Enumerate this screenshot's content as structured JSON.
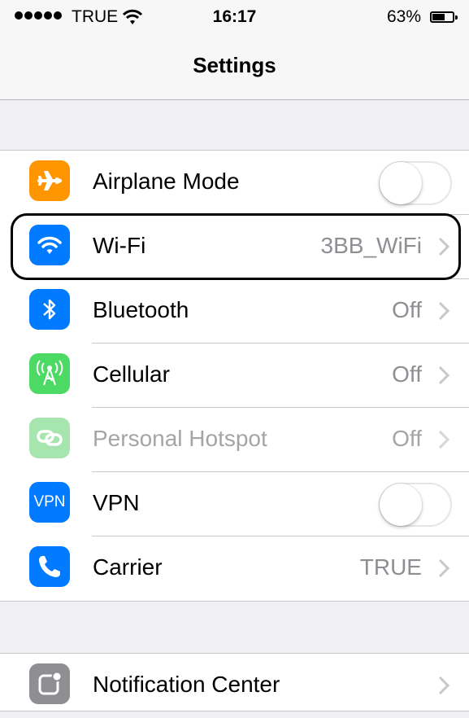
{
  "status_bar": {
    "carrier": "TRUE",
    "time": "16:17",
    "battery_percent": "63%",
    "battery_level": 0.63
  },
  "nav": {
    "title": "Settings"
  },
  "group1": [
    {
      "id": "airplane",
      "label": "Airplane Mode",
      "icon": "airplane-icon",
      "icon_color": "#ff9500",
      "control": "toggle",
      "on": false
    },
    {
      "id": "wifi",
      "label": "Wi-Fi",
      "icon": "wifi-icon",
      "icon_color": "#007aff",
      "value": "3BB_WiFi"
    },
    {
      "id": "bluetooth",
      "label": "Bluetooth",
      "icon": "bluetooth-icon",
      "icon_color": "#007aff",
      "value": "Off"
    },
    {
      "id": "cellular",
      "label": "Cellular",
      "icon": "cellular-antenna-icon",
      "icon_color": "#4cd964",
      "value": "Off"
    },
    {
      "id": "hotspot",
      "label": "Personal Hotspot",
      "icon": "hotspot-link-icon",
      "icon_color": "#a6e5ae",
      "value": "Off",
      "disabled": true
    },
    {
      "id": "vpn",
      "label": "VPN",
      "icon": "vpn-icon",
      "icon_text": "VPN",
      "icon_color": "#007aff",
      "control": "toggle",
      "on": false
    },
    {
      "id": "carrier",
      "label": "Carrier",
      "icon": "phone-icon",
      "icon_color": "#007aff",
      "value": "TRUE"
    }
  ],
  "group2": [
    {
      "id": "notification_center",
      "label": "Notification Center",
      "icon": "notification-center-icon",
      "icon_color": "#8e8e93"
    }
  ]
}
